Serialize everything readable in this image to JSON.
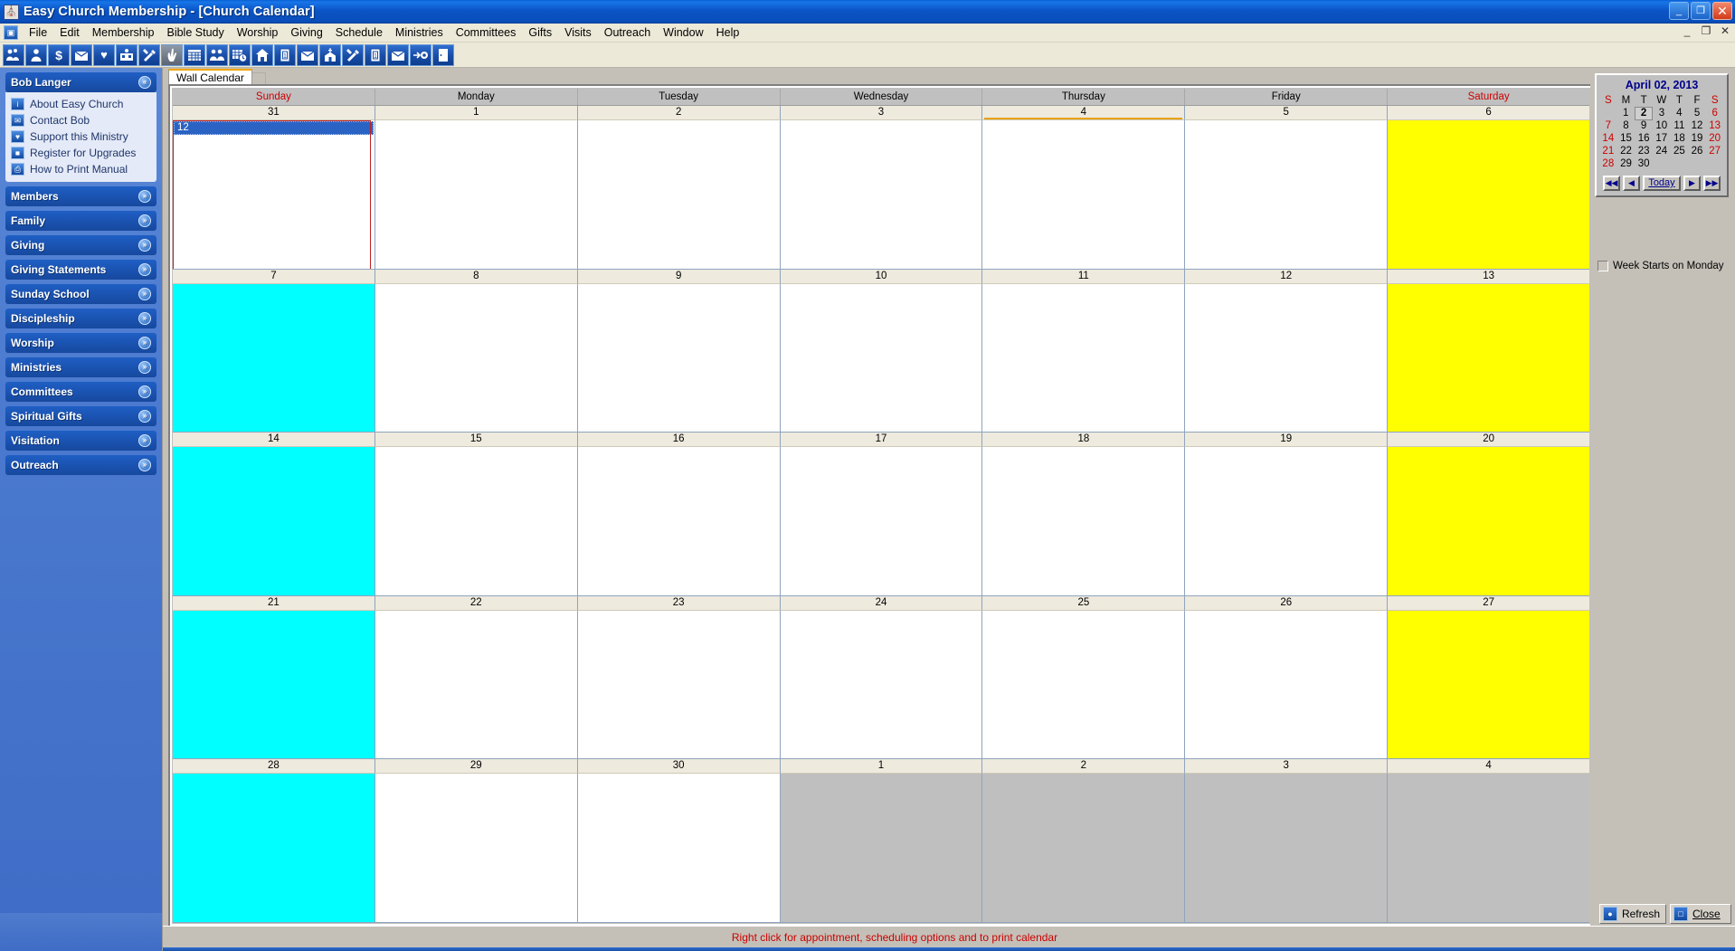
{
  "window": {
    "title": "Easy Church Membership - [Church Calendar]",
    "app_icon": "church-icon",
    "minimize_label": "_",
    "maximize_label": "❐",
    "close_label": "✕",
    "mdi_minimize_label": "_",
    "mdi_restore_label": "❐",
    "mdi_close_label": "✕"
  },
  "menu": {
    "mdi_icon": "document-icon",
    "items": [
      "File",
      "Edit",
      "Membership",
      "Bible Study",
      "Worship",
      "Giving",
      "Schedule",
      "Ministries",
      "Committees",
      "Gifts",
      "Visits",
      "Outreach",
      "Window",
      "Help"
    ]
  },
  "toolbar": {
    "buttons": [
      {
        "name": "members-icon",
        "glyph": "\u0001"
      },
      {
        "name": "person-icon",
        "glyph": "\u0002"
      },
      {
        "name": "dollar-icon",
        "glyph": "$"
      },
      {
        "name": "giving-statement-icon",
        "glyph": "\u0003"
      },
      {
        "name": "heart-icon",
        "glyph": "♥"
      },
      {
        "name": "sunday-school-icon",
        "glyph": "\u0004"
      },
      {
        "name": "tools-icon",
        "glyph": "\u0005"
      },
      {
        "name": "praying-hands-icon",
        "glyph": "\u0006"
      },
      {
        "name": "grid-calendar-icon",
        "glyph": "\u0007"
      },
      {
        "name": "group-icon",
        "glyph": "\b"
      },
      {
        "name": "schedule-clock-icon",
        "glyph": "\u000b"
      },
      {
        "name": "home-icon",
        "glyph": "⌂"
      },
      {
        "name": "clipboard-icon",
        "glyph": "\f"
      },
      {
        "name": "mail-out-icon",
        "glyph": "\u000e"
      },
      {
        "name": "church-building-icon",
        "glyph": "\u000f"
      },
      {
        "name": "wrench-icon",
        "glyph": "\u0010"
      },
      {
        "name": "clipboard2-icon",
        "glyph": "\u0011"
      },
      {
        "name": "mail-out2-icon",
        "glyph": "\u0012"
      },
      {
        "name": "outreach-icon",
        "glyph": "\u0013"
      },
      {
        "name": "exit-door-icon",
        "glyph": "\u0014"
      }
    ]
  },
  "sidebar": {
    "user_panel": {
      "title": "Bob Langer",
      "chevron": "«",
      "links": [
        {
          "label": "About Easy Church",
          "icon": "info-icon",
          "glyph": "i"
        },
        {
          "label": "Contact Bob",
          "icon": "envelope-icon",
          "glyph": "✉"
        },
        {
          "label": "Support this Ministry",
          "icon": "heart-icon",
          "glyph": "♥"
        },
        {
          "label": "Register for Upgrades",
          "icon": "camera-icon",
          "glyph": "■"
        },
        {
          "label": "How to Print Manual",
          "icon": "printer-icon",
          "glyph": "⎙"
        }
      ]
    },
    "sections": [
      {
        "label": "Members",
        "chevron": "»"
      },
      {
        "label": "Family",
        "chevron": "»"
      },
      {
        "label": "Giving",
        "chevron": "»"
      },
      {
        "label": "Giving Statements",
        "chevron": "»"
      },
      {
        "label": "Sunday School",
        "chevron": "»"
      },
      {
        "label": "Discipleship",
        "chevron": "»"
      },
      {
        "label": "Worship",
        "chevron": "»"
      },
      {
        "label": "Ministries",
        "chevron": "»"
      },
      {
        "label": "Committees",
        "chevron": "»"
      },
      {
        "label": "Spiritual Gifts",
        "chevron": "»"
      },
      {
        "label": "Visitation",
        "chevron": "»"
      },
      {
        "label": "Outreach",
        "chevron": "»"
      }
    ]
  },
  "content": {
    "tab_label": "Wall Calendar"
  },
  "calendar": {
    "day_names": [
      "Sunday",
      "Monday",
      "Tuesday",
      "Wednesday",
      "Thursday",
      "Friday",
      "Saturday"
    ],
    "weekend_columns": [
      0,
      6
    ],
    "weeks": [
      [
        {
          "date": "31",
          "fill": "white",
          "selected_column": true,
          "appointment": "12"
        },
        {
          "date": "1",
          "fill": "white"
        },
        {
          "date": "2",
          "fill": "white"
        },
        {
          "date": "3",
          "fill": "white"
        },
        {
          "date": "4",
          "fill": "white",
          "today": true
        },
        {
          "date": "5",
          "fill": "white"
        },
        {
          "date": "6",
          "fill": "yellow"
        }
      ],
      [
        {
          "date": "7",
          "fill": "cyan"
        },
        {
          "date": "8",
          "fill": "white"
        },
        {
          "date": "9",
          "fill": "white"
        },
        {
          "date": "10",
          "fill": "white"
        },
        {
          "date": "11",
          "fill": "white"
        },
        {
          "date": "12",
          "fill": "white"
        },
        {
          "date": "13",
          "fill": "yellow"
        }
      ],
      [
        {
          "date": "14",
          "fill": "cyan"
        },
        {
          "date": "15",
          "fill": "white"
        },
        {
          "date": "16",
          "fill": "white"
        },
        {
          "date": "17",
          "fill": "white"
        },
        {
          "date": "18",
          "fill": "white"
        },
        {
          "date": "19",
          "fill": "white"
        },
        {
          "date": "20",
          "fill": "yellow"
        }
      ],
      [
        {
          "date": "21",
          "fill": "cyan"
        },
        {
          "date": "22",
          "fill": "white"
        },
        {
          "date": "23",
          "fill": "white"
        },
        {
          "date": "24",
          "fill": "white"
        },
        {
          "date": "25",
          "fill": "white"
        },
        {
          "date": "26",
          "fill": "white"
        },
        {
          "date": "27",
          "fill": "yellow"
        }
      ],
      [
        {
          "date": "28",
          "fill": "cyan"
        },
        {
          "date": "29",
          "fill": "white"
        },
        {
          "date": "30",
          "fill": "white"
        },
        {
          "date": "1",
          "fill": "gray"
        },
        {
          "date": "2",
          "fill": "gray"
        },
        {
          "date": "3",
          "fill": "gray"
        },
        {
          "date": "4",
          "fill": "gray"
        }
      ]
    ]
  },
  "minicalendar": {
    "title": "April 02, 2013",
    "weekday_headers": [
      "S",
      "M",
      "T",
      "W",
      "T",
      "F",
      "S"
    ],
    "rows": [
      [
        "",
        "1",
        "2",
        "3",
        "4",
        "5",
        "6"
      ],
      [
        "7",
        "8",
        "9",
        "10",
        "11",
        "12",
        "13"
      ],
      [
        "14",
        "15",
        "16",
        "17",
        "18",
        "19",
        "20"
      ],
      [
        "21",
        "22",
        "23",
        "24",
        "25",
        "26",
        "27"
      ],
      [
        "28",
        "29",
        "30",
        "",
        "",
        "",
        ""
      ]
    ],
    "selected_day": "2",
    "nav": {
      "prev_year": "◀◀",
      "prev_month": "◀",
      "today": "Today",
      "next_month": "▶",
      "next_year": "▶▶"
    },
    "week_starts_monday": {
      "label": "Week Starts on Monday",
      "checked": false
    }
  },
  "actions": {
    "refresh": {
      "label": "Refresh",
      "icon": "refresh-icon",
      "glyph": "●"
    },
    "close": {
      "label": "Close",
      "icon": "exit-door-icon",
      "glyph": "□"
    }
  },
  "status": {
    "message": "Right click for appointment, scheduling options and to print calendar"
  },
  "colors": {
    "title_blue": "#0b54c6",
    "accent_orange": "#e8a317",
    "cell_cyan": "#00ffff",
    "cell_yellow": "#ffff00",
    "cell_gray": "#bfbfbf",
    "status_red": "#cc0000",
    "selection_blue": "#2b63c4"
  }
}
